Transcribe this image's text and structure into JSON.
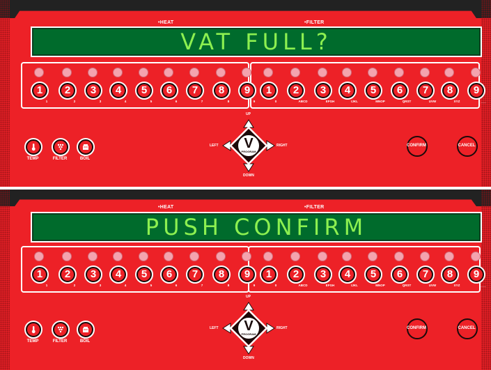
{
  "panels": [
    {
      "id": "top",
      "display_text": "VAT FULL?",
      "heat_label": "•HEAT",
      "filter_label": "•FILTER"
    },
    {
      "id": "bottom",
      "display_text": "PUSH CONFIRM",
      "heat_label": "•HEAT",
      "filter_label": "•FILTER"
    }
  ],
  "left_keys": [
    {
      "num": "1",
      "sub": "1"
    },
    {
      "num": "2",
      "sub": "2"
    },
    {
      "num": "3",
      "sub": "3"
    },
    {
      "num": "4",
      "sub": "4"
    },
    {
      "num": "5",
      "sub": "5"
    },
    {
      "num": "6",
      "sub": "6"
    },
    {
      "num": "7",
      "sub": "7"
    },
    {
      "num": "8",
      "sub": "8"
    },
    {
      "num": "9",
      "sub": "9"
    }
  ],
  "right_keys": [
    {
      "num": "1",
      "sub": "0"
    },
    {
      "num": "2",
      "sub": "ABCD"
    },
    {
      "num": "3",
      "sub": "EFGH"
    },
    {
      "num": "4",
      "sub": "IJKL"
    },
    {
      "num": "5",
      "sub": "MNOP"
    },
    {
      "num": "6",
      "sub": "QRST"
    },
    {
      "num": "7",
      "sub": "UVW"
    },
    {
      "num": "8",
      "sub": "XYZ"
    },
    {
      "num": "9",
      "sub": "___"
    }
  ],
  "function_buttons": [
    {
      "name": "temp",
      "label": "TEMP",
      "icon": "thermometer-icon"
    },
    {
      "name": "filter",
      "label": "FILTER",
      "icon": "filter-icon"
    },
    {
      "name": "boil",
      "label": "BOIL",
      "icon": "boil-icon"
    }
  ],
  "nav": {
    "up": "UP",
    "down": "DOWN",
    "left": "LEFT",
    "right": "RIGHT",
    "center_letter": "V",
    "center_text": "PROGRAM"
  },
  "confirm_label": "CONFIRM",
  "cancel_label": "CANCEL",
  "colors": {
    "panel": "#ed2127",
    "display_bg": "#006b2c",
    "display_text": "#8cf050",
    "led": "#f4a3ae"
  }
}
